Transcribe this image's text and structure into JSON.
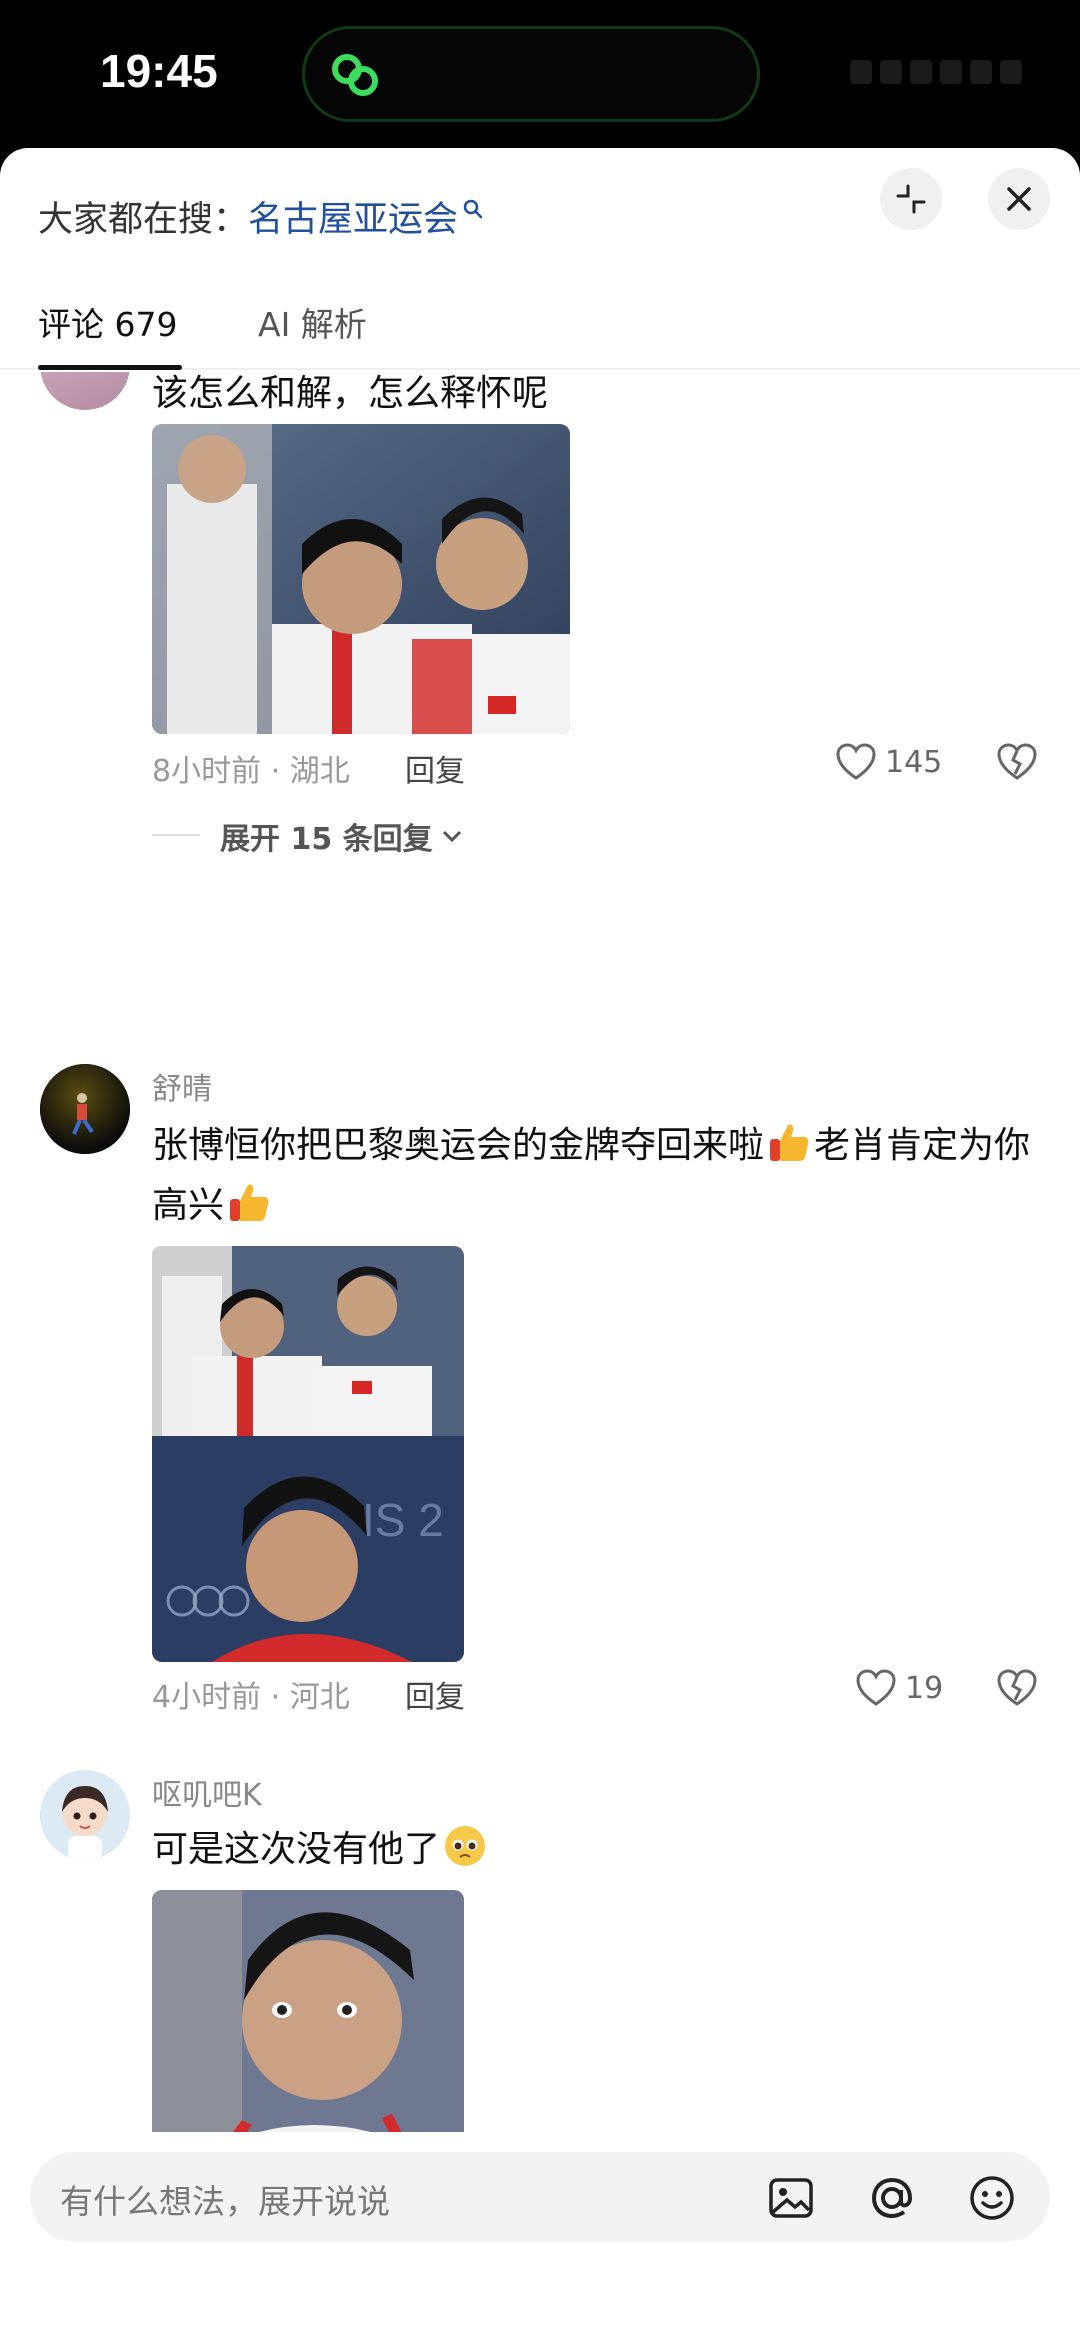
{
  "status": {
    "time": "19:45"
  },
  "header": {
    "search_prefix": "大家都在搜：",
    "search_term": "名古屋亚运会"
  },
  "tabs": [
    {
      "label": "评论 679"
    },
    {
      "label": "AI 解析"
    }
  ],
  "comments": [
    {
      "text": "该怎么和解，怎么释怀呢",
      "meta": "8小时前 · 湖北",
      "reply_label": "回复",
      "likes": "145",
      "expand_label": "展开 15 条回复"
    },
    {
      "username": "舒晴",
      "text_part1": "张博恒你把巴黎奥运会的金牌夺回来啦",
      "text_part2": "老肖肯定为你高兴",
      "meta": "4小时前 · 河北",
      "reply_label": "回复",
      "likes": "19"
    },
    {
      "username": "呕叽吧K",
      "text": "可是这次没有他了"
    }
  ],
  "input": {
    "placeholder": "有什么想法，展开说说"
  },
  "colors": {
    "link": "#1f4f9e",
    "accent_green": "#3ddc5c"
  }
}
